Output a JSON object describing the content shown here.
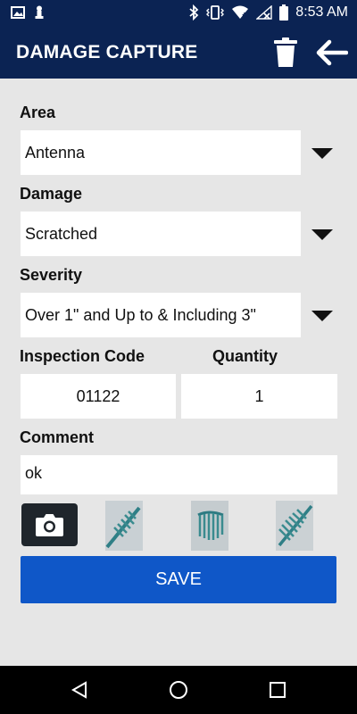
{
  "status_bar": {
    "time": "8:53 AM"
  },
  "appbar": {
    "title": "DAMAGE CAPTURE",
    "icons": [
      "trash-icon",
      "arrow-left-icon"
    ]
  },
  "form": {
    "area": {
      "label": "Area",
      "value": "Antenna"
    },
    "damage": {
      "label": "Damage",
      "value": "Scratched"
    },
    "severity": {
      "label": "Severity",
      "value": "Over 1\" and Up to & Including 3\""
    },
    "inspection_code": {
      "label": "Inspection Code",
      "value": "01122"
    },
    "quantity": {
      "label": "Quantity",
      "value": "1"
    },
    "comment": {
      "label": "Comment",
      "value": "ok"
    }
  },
  "photos": {
    "count": 3
  },
  "save_label": "SAVE",
  "colors": {
    "header": "#0b2353",
    "save": "#0f57c8",
    "background": "#e6e6e6"
  }
}
